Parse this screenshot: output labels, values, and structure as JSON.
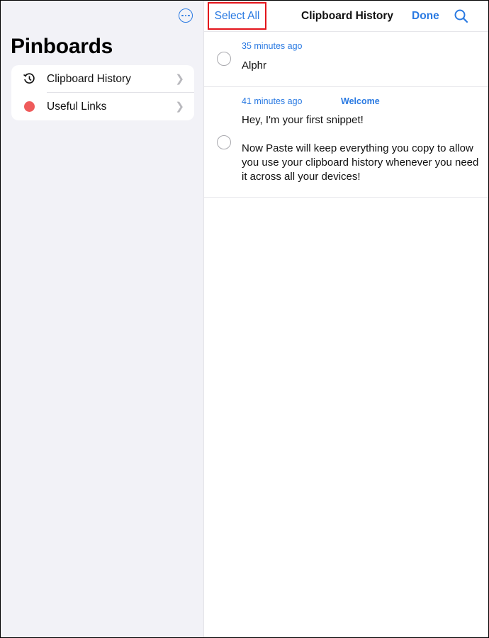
{
  "sidebar": {
    "title": "Pinboards",
    "more_button": "more-options",
    "items": [
      {
        "label": "Clipboard History",
        "icon": "history-clock-icon"
      },
      {
        "label": "Useful Links",
        "icon": "red-dot-icon",
        "color": "#ef5b5b"
      }
    ]
  },
  "topbar": {
    "select_all_label": "Select All",
    "title": "Clipboard History",
    "done_label": "Done",
    "search_icon": "search-icon"
  },
  "clips": [
    {
      "time": "35 minutes ago",
      "tag": "",
      "text": "Alphr"
    },
    {
      "time": "41 minutes ago",
      "tag": "Welcome",
      "text": "Hey, I'm your first snippet!\n\nNow Paste will keep everything you copy to allow you use your clipboard history whenever you need it across all your devices!"
    }
  ],
  "colors": {
    "accent": "#2a7ae2",
    "highlight_box": "#e3141b"
  }
}
